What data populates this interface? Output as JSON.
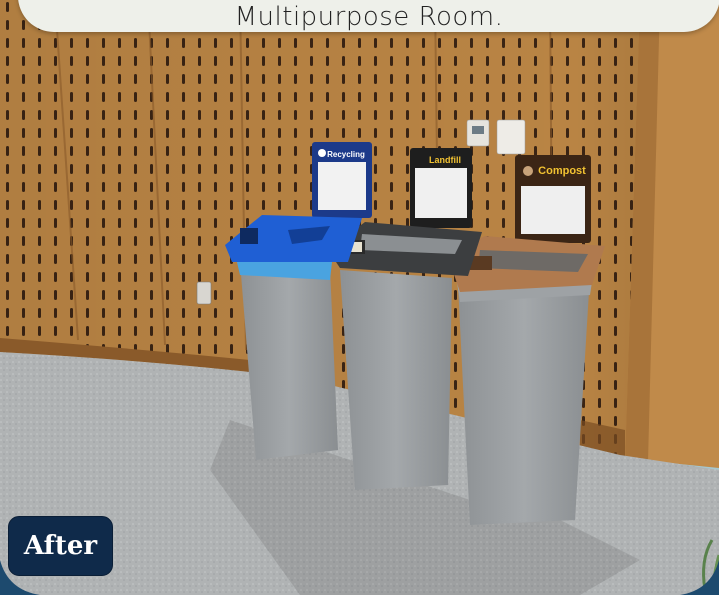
{
  "caption": {
    "text": "Multipurpose Room."
  },
  "badge": {
    "label": "After"
  },
  "signs": {
    "recycling": "Recycling",
    "landfill": "Landfill",
    "compost": "Compost"
  },
  "colors": {
    "frame": "#1d4a6e",
    "badge_bg": "#0f2a4a",
    "recycling_lid": "#1f5fd4",
    "landfill_lid": "#3c3e40",
    "compost_lid": "#b07a4e",
    "bin_body": "#9a9ea1",
    "wall_wood": "#b98444",
    "carpet": "#b3b5b6"
  }
}
